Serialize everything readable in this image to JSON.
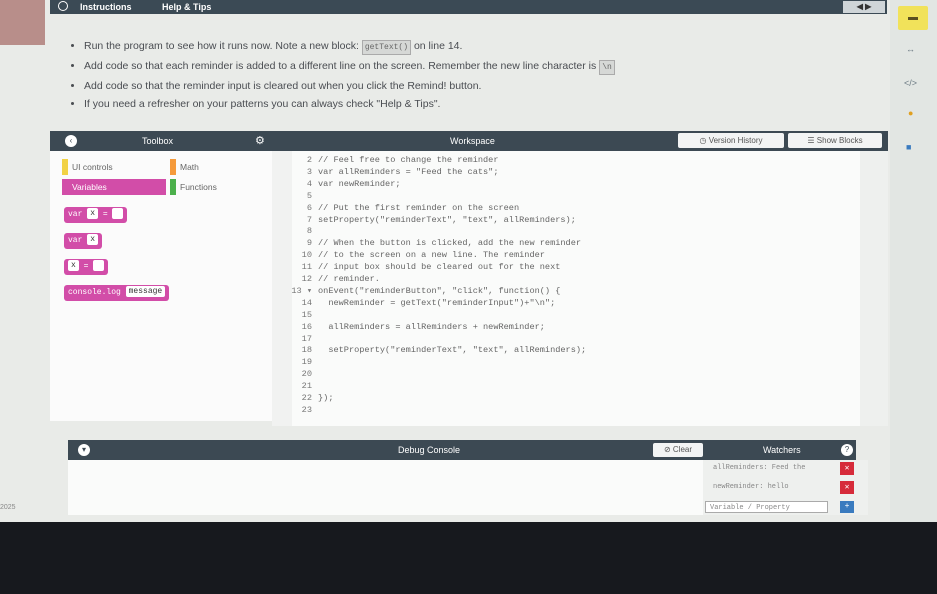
{
  "topbar": {
    "tab_instructions": "Instructions",
    "tab_help": "Help & Tips",
    "audio": "◀ ▶"
  },
  "instructions": [
    {
      "text_before": "Run the program to see how it runs now. Note a new block: ",
      "chip": "getText()",
      "text_after": " on line 14."
    },
    {
      "text_before": "Add code so that each reminder is added to a different line on the screen. Remember the new line character is ",
      "chip": "\\n",
      "text_after": ""
    },
    {
      "text_before": "Add code so that the reminder input is cleared out when you click the Remind! button.",
      "chip": "",
      "text_after": ""
    },
    {
      "text_before": "If you need a refresher on your patterns you can always check \"Help & Tips\".",
      "chip": "",
      "text_after": ""
    }
  ],
  "panel": {
    "toolbox_title": "Toolbox",
    "workspace_title": "Workspace",
    "version_history": "Version History",
    "show_blocks": "Show Blocks"
  },
  "toolbox": {
    "categories": [
      {
        "label": "UI controls",
        "color": "#f2d245"
      },
      {
        "label": "Math",
        "color": "#f59a3b"
      },
      {
        "label": "Variables",
        "color": "#d24da8"
      },
      {
        "label": "Functions",
        "color": "#4cb04c"
      }
    ],
    "blocks": {
      "var_assign_kw": "var",
      "var_assign_name": "x",
      "var_assign_op": "=",
      "var_decl_kw": "var",
      "var_decl_name": "x",
      "assign_name": "x",
      "assign_op": "=",
      "log_obj": "console",
      "log_fn": ".log",
      "log_arg": "message"
    }
  },
  "workspace": {
    "lines": [
      {
        "n": "2",
        "code": "// Feel free to change the reminder"
      },
      {
        "n": "3",
        "code": "var allReminders = \"Feed the cats\";"
      },
      {
        "n": "4",
        "code": "var newReminder;"
      },
      {
        "n": "5",
        "code": ""
      },
      {
        "n": "6",
        "code": "// Put the first reminder on the screen"
      },
      {
        "n": "7",
        "code": "setProperty(\"reminderText\", \"text\", allReminders);"
      },
      {
        "n": "8",
        "code": ""
      },
      {
        "n": "9",
        "code": "// When the button is clicked, add the new reminder"
      },
      {
        "n": "10",
        "code": "// to the screen on a new line. The reminder"
      },
      {
        "n": "11",
        "code": "// input box should be cleared out for the next"
      },
      {
        "n": "12",
        "code": "// reminder."
      },
      {
        "n": "13 ▾",
        "code": "onEvent(\"reminderButton\", \"click\", function() {"
      },
      {
        "n": "14",
        "code": "  newReminder = getText(\"reminderInput\")+\"\\n\";"
      },
      {
        "n": "15",
        "code": ""
      },
      {
        "n": "16",
        "code": "  allReminders = allReminders + newReminder;"
      },
      {
        "n": "17",
        "code": ""
      },
      {
        "n": "18",
        "code": "  setProperty(\"reminderText\", \"text\", allReminders);"
      },
      {
        "n": "19",
        "code": ""
      },
      {
        "n": "20",
        "code": ""
      },
      {
        "n": "21",
        "code": ""
      },
      {
        "n": "22",
        "code": "});"
      },
      {
        "n": "23",
        "code": ""
      }
    ]
  },
  "debug": {
    "title": "Debug Console",
    "clear": "Clear",
    "watchers": "Watchers",
    "watch_rows": [
      "allReminders: Feed the",
      "newReminder: hello"
    ],
    "watch_placeholder": "Variable / Property"
  },
  "footer": {
    "date": "2025"
  }
}
